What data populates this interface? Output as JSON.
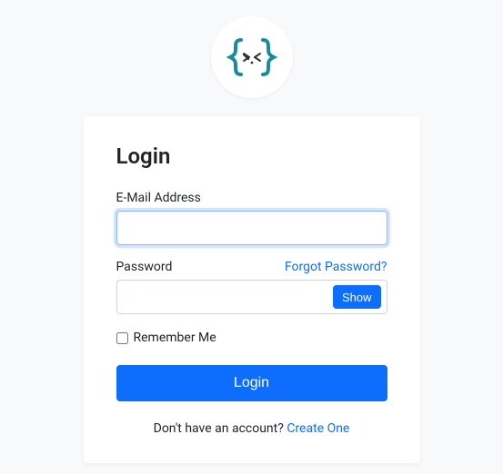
{
  "logo": {
    "name": "curly-braces-logo"
  },
  "card": {
    "title": "Login",
    "email": {
      "label": "E-Mail Address",
      "value": ""
    },
    "password": {
      "label": "Password",
      "forgot_label": "Forgot Password?",
      "value": "",
      "show_button": "Show"
    },
    "remember": {
      "label": "Remember Me",
      "checked": false
    },
    "submit_label": "Login",
    "footer": {
      "prompt": "Don't have an account? ",
      "link": "Create One"
    }
  }
}
